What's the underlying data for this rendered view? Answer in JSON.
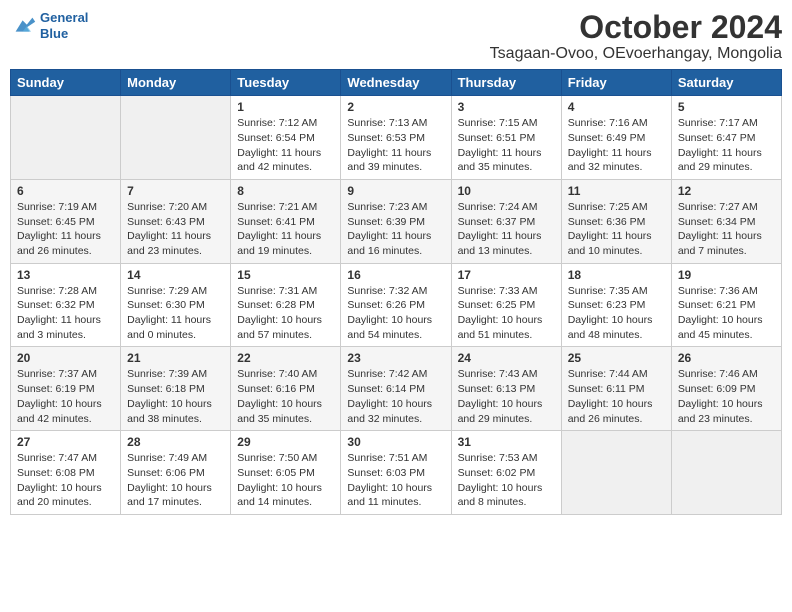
{
  "logo": {
    "line1": "General",
    "line2": "Blue"
  },
  "title": "October 2024",
  "location": "Tsagaan-Ovoo, OEvoerhangay, Mongolia",
  "weekdays": [
    "Sunday",
    "Monday",
    "Tuesday",
    "Wednesday",
    "Thursday",
    "Friday",
    "Saturday"
  ],
  "weeks": [
    [
      {
        "day": null,
        "info": null
      },
      {
        "day": null,
        "info": null
      },
      {
        "day": "1",
        "sunrise": "7:12 AM",
        "sunset": "6:54 PM",
        "daylight": "11 hours and 42 minutes."
      },
      {
        "day": "2",
        "sunrise": "7:13 AM",
        "sunset": "6:53 PM",
        "daylight": "11 hours and 39 minutes."
      },
      {
        "day": "3",
        "sunrise": "7:15 AM",
        "sunset": "6:51 PM",
        "daylight": "11 hours and 35 minutes."
      },
      {
        "day": "4",
        "sunrise": "7:16 AM",
        "sunset": "6:49 PM",
        "daylight": "11 hours and 32 minutes."
      },
      {
        "day": "5",
        "sunrise": "7:17 AM",
        "sunset": "6:47 PM",
        "daylight": "11 hours and 29 minutes."
      }
    ],
    [
      {
        "day": "6",
        "sunrise": "7:19 AM",
        "sunset": "6:45 PM",
        "daylight": "11 hours and 26 minutes."
      },
      {
        "day": "7",
        "sunrise": "7:20 AM",
        "sunset": "6:43 PM",
        "daylight": "11 hours and 23 minutes."
      },
      {
        "day": "8",
        "sunrise": "7:21 AM",
        "sunset": "6:41 PM",
        "daylight": "11 hours and 19 minutes."
      },
      {
        "day": "9",
        "sunrise": "7:23 AM",
        "sunset": "6:39 PM",
        "daylight": "11 hours and 16 minutes."
      },
      {
        "day": "10",
        "sunrise": "7:24 AM",
        "sunset": "6:37 PM",
        "daylight": "11 hours and 13 minutes."
      },
      {
        "day": "11",
        "sunrise": "7:25 AM",
        "sunset": "6:36 PM",
        "daylight": "11 hours and 10 minutes."
      },
      {
        "day": "12",
        "sunrise": "7:27 AM",
        "sunset": "6:34 PM",
        "daylight": "11 hours and 7 minutes."
      }
    ],
    [
      {
        "day": "13",
        "sunrise": "7:28 AM",
        "sunset": "6:32 PM",
        "daylight": "11 hours and 3 minutes."
      },
      {
        "day": "14",
        "sunrise": "7:29 AM",
        "sunset": "6:30 PM",
        "daylight": "11 hours and 0 minutes."
      },
      {
        "day": "15",
        "sunrise": "7:31 AM",
        "sunset": "6:28 PM",
        "daylight": "10 hours and 57 minutes."
      },
      {
        "day": "16",
        "sunrise": "7:32 AM",
        "sunset": "6:26 PM",
        "daylight": "10 hours and 54 minutes."
      },
      {
        "day": "17",
        "sunrise": "7:33 AM",
        "sunset": "6:25 PM",
        "daylight": "10 hours and 51 minutes."
      },
      {
        "day": "18",
        "sunrise": "7:35 AM",
        "sunset": "6:23 PM",
        "daylight": "10 hours and 48 minutes."
      },
      {
        "day": "19",
        "sunrise": "7:36 AM",
        "sunset": "6:21 PM",
        "daylight": "10 hours and 45 minutes."
      }
    ],
    [
      {
        "day": "20",
        "sunrise": "7:37 AM",
        "sunset": "6:19 PM",
        "daylight": "10 hours and 42 minutes."
      },
      {
        "day": "21",
        "sunrise": "7:39 AM",
        "sunset": "6:18 PM",
        "daylight": "10 hours and 38 minutes."
      },
      {
        "day": "22",
        "sunrise": "7:40 AM",
        "sunset": "6:16 PM",
        "daylight": "10 hours and 35 minutes."
      },
      {
        "day": "23",
        "sunrise": "7:42 AM",
        "sunset": "6:14 PM",
        "daylight": "10 hours and 32 minutes."
      },
      {
        "day": "24",
        "sunrise": "7:43 AM",
        "sunset": "6:13 PM",
        "daylight": "10 hours and 29 minutes."
      },
      {
        "day": "25",
        "sunrise": "7:44 AM",
        "sunset": "6:11 PM",
        "daylight": "10 hours and 26 minutes."
      },
      {
        "day": "26",
        "sunrise": "7:46 AM",
        "sunset": "6:09 PM",
        "daylight": "10 hours and 23 minutes."
      }
    ],
    [
      {
        "day": "27",
        "sunrise": "7:47 AM",
        "sunset": "6:08 PM",
        "daylight": "10 hours and 20 minutes."
      },
      {
        "day": "28",
        "sunrise": "7:49 AM",
        "sunset": "6:06 PM",
        "daylight": "10 hours and 17 minutes."
      },
      {
        "day": "29",
        "sunrise": "7:50 AM",
        "sunset": "6:05 PM",
        "daylight": "10 hours and 14 minutes."
      },
      {
        "day": "30",
        "sunrise": "7:51 AM",
        "sunset": "6:03 PM",
        "daylight": "10 hours and 11 minutes."
      },
      {
        "day": "31",
        "sunrise": "7:53 AM",
        "sunset": "6:02 PM",
        "daylight": "10 hours and 8 minutes."
      },
      {
        "day": null,
        "info": null
      },
      {
        "day": null,
        "info": null
      }
    ]
  ],
  "labels": {
    "sunrise": "Sunrise:",
    "sunset": "Sunset:",
    "daylight": "Daylight:"
  }
}
